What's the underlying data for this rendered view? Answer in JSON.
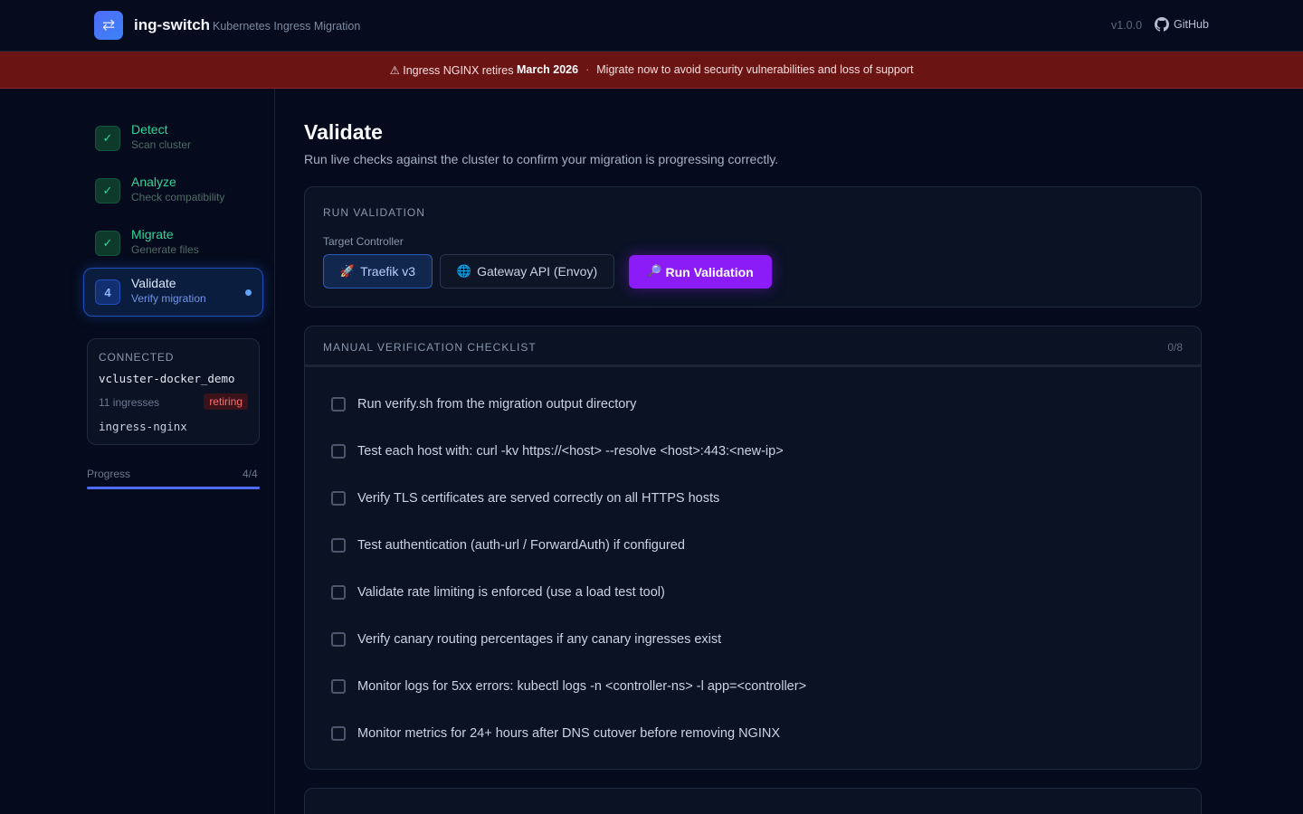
{
  "header": {
    "logo_glyph": "⇄",
    "app_name": "ing-switch",
    "app_subtitle": "Kubernetes Ingress Migration",
    "version": "v1.0.0",
    "github_label": "GitHub"
  },
  "banner": {
    "prefix": "⚠ Ingress NGINX retires ",
    "date": "March 2026",
    "separator": "·",
    "message": "Migrate now to avoid security vulnerabilities and loss of support"
  },
  "sidebar": {
    "steps": [
      {
        "badge": "✓",
        "title": "Detect",
        "desc": "Scan cluster",
        "state": "done"
      },
      {
        "badge": "✓",
        "title": "Analyze",
        "desc": "Check compatibility",
        "state": "done"
      },
      {
        "badge": "✓",
        "title": "Migrate",
        "desc": "Generate files",
        "state": "done"
      },
      {
        "badge": "4",
        "title": "Validate",
        "desc": "Verify migration",
        "state": "active"
      }
    ],
    "connection": {
      "label": "CONNECTED",
      "cluster": "vcluster-docker_demo",
      "ingress_count": "11 ingresses",
      "status_badge": "retiring",
      "controller": "ingress-nginx"
    },
    "progress": {
      "label": "Progress",
      "count": "4/4",
      "fraction": 1.0
    }
  },
  "main": {
    "title": "Validate",
    "subtitle": "Run live checks against the cluster to confirm your migration is progressing correctly.",
    "run_validation": {
      "heading": "RUN VALIDATION",
      "target_label": "Target Controller",
      "options": [
        {
          "icon": "🚀",
          "label": "Traefik v3",
          "selected": true
        },
        {
          "icon": "🌐",
          "label": "Gateway API (Envoy)",
          "selected": false
        }
      ],
      "run_icon": "🔎",
      "run_label": "Run Validation"
    },
    "checklist": {
      "heading": "MANUAL VERIFICATION CHECKLIST",
      "count": "0/8",
      "items": [
        "Run verify.sh from the migration output directory",
        "Test each host with: curl -kv https://<host> --resolve <host>:443:<new-ip>",
        "Verify TLS certificates are served correctly on all HTTPS hosts",
        "Test authentication (auth-url / ForwardAuth) if configured",
        "Validate rate limiting is enforced (use a load test tool)",
        "Verify canary routing percentages if any canary ingresses exist",
        "Monitor logs for 5xx errors: kubectl logs -n <controller-ns> -l app=<controller>",
        "Monitor metrics for 24+ hours after DNS cutover before removing NGINX"
      ]
    }
  },
  "colors": {
    "accent": "#4f6cf7",
    "success": "#34d399",
    "danger_banner": "#6b1414",
    "run_button": "#8b1cf7"
  }
}
